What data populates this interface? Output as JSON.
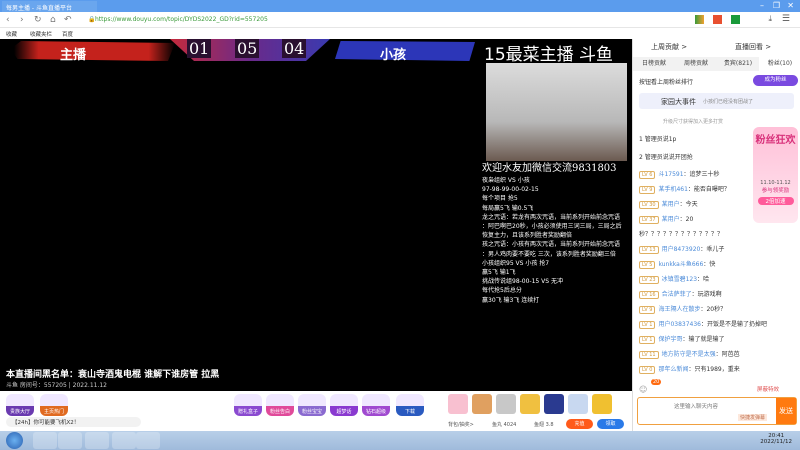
{
  "browser": {
    "tab_title": "每男主播 - 斗鱼直播平台",
    "url": "https://www.douyu.com/topic/DYDS2022_GD?rid=557205",
    "bookmarks": [
      "收藏",
      "收藏夹栏",
      "百度"
    ]
  },
  "video": {
    "host_label": "主播",
    "kid_label": "小孩",
    "scores": [
      "01",
      "05",
      "04"
    ],
    "brand": "15最菜主播 斗鱼",
    "overlay_lines": [
      "欢迎水友加微信交流9831803",
      "夜枭组织 VS 小孩",
      "97-98-99-00-02-15",
      "每个项目 抢5",
      "每局赢5飞 输0.5飞",
      "龙之咒语：若龙有两次咒语，当前系列开始前念咒语",
      "：阿巴啊巴20秒，小孩必须使用三词三局，三局之后",
      "恢复主力，且该系列胜者奖励翻倍",
      "孩之咒语：小孩有两次咒语，当前系列开始前念咒语",
      "：男人鸡肉要不要吃 三次，该系列胜者奖励翻三倍",
      "小孩组织95 VS 小孩 抢7",
      "赢5飞 输1飞",
      "挑战传说组98-00-15 VS 无冲",
      "每代抢5后总分",
      "赢30飞 输3飞 连续打"
    ],
    "caption": "本直播间黑名单：衰山寺酒鬼电棍 谁解下谁房管 拉黑",
    "room_info": "斗鱼 房间号：557205 | 2022.11.12"
  },
  "gifts": {
    "buttons": [
      "贵族大厅",
      "主页热门",
      "赠礼盒子",
      "粉丝告白",
      "粉丝宝宝",
      "超梦话",
      "钻石超级",
      "下载"
    ],
    "notice": "【24h】你可能要飞机X2！",
    "backpack": "背包/抽奖>",
    "balance": "鱼丸 4024",
    "fish": "鱼翅 3.8",
    "recharge": "充值",
    "sign": "领取"
  },
  "sidebar": {
    "links": [
      "上周贡献 >",
      "直播回看 >"
    ],
    "tabs": [
      "日榜贡献",
      "周榜贡献",
      "贵宾(821)",
      "粉丝(10)"
    ],
    "active_tab": 3,
    "rank_label": "按钮看上周粉丝排行",
    "join_btn": "成为粉丝",
    "event_title": "家园大事件",
    "event_desc": "小孩们已经没有团战了",
    "hint": "升级尺寸获得加入更多打赏",
    "pinned": [
      "1 管理员说1p",
      "2 管理员说说开团抢"
    ],
    "promo": {
      "title": "粉丝狂欢",
      "dates": "11.10-11.12",
      "sub": "参与领奖励",
      "btn": "2倍加速"
    },
    "messages": [
      {
        "lv": "LV 6",
        "nick": "斗17591",
        "text": "：追梦三十秒"
      },
      {
        "lv": "LV 9",
        "nick": "某手机461",
        "text": "：能否自曝吧？"
      },
      {
        "lv": "LV 30",
        "nick": "某用户",
        "text": "：今天"
      },
      {
        "lv": "LV 37",
        "nick": "某用户",
        "text": "：20"
      },
      {
        "lv": "",
        "nick": "",
        "text": "秒？？？？？？？？？？？？？"
      },
      {
        "lv": "LV 13",
        "nick": "用户8473920",
        "text": "：乖儿子"
      },
      {
        "lv": "LV 5",
        "nick": "kunkka斗鱼666",
        "text": "：快"
      },
      {
        "lv": "LV 23",
        "nick": "冰镇雪碧123",
        "text": "：哈"
      },
      {
        "lv": "LV 16",
        "nick": "合法萨菲了",
        "text": "：玩游戏啊"
      },
      {
        "lv": "LV 9",
        "nick": "海王隔人在散步",
        "text": "：20秒？"
      },
      {
        "lv": "LV 1",
        "nick": "用户03837436",
        "text": "：开饭是不是输了扔掉吧"
      },
      {
        "lv": "LV 1",
        "nick": "保护宇哥",
        "text": "：输了就是输了"
      },
      {
        "lv": "LV 11",
        "nick": "地方防守是不是太强",
        "text": "：阿芭芭"
      },
      {
        "lv": "LV 0",
        "nick": "那年么新闻",
        "text": "：只有1989，重来"
      }
    ],
    "badge_count": "20",
    "shield_label": "屏蔽特效",
    "input_placeholder": "这里输入聊天内容",
    "input_hint": "快捷发弹幕",
    "send": "发送"
  },
  "taskbar": {
    "time": "20:41",
    "date": "2022/11/12"
  }
}
